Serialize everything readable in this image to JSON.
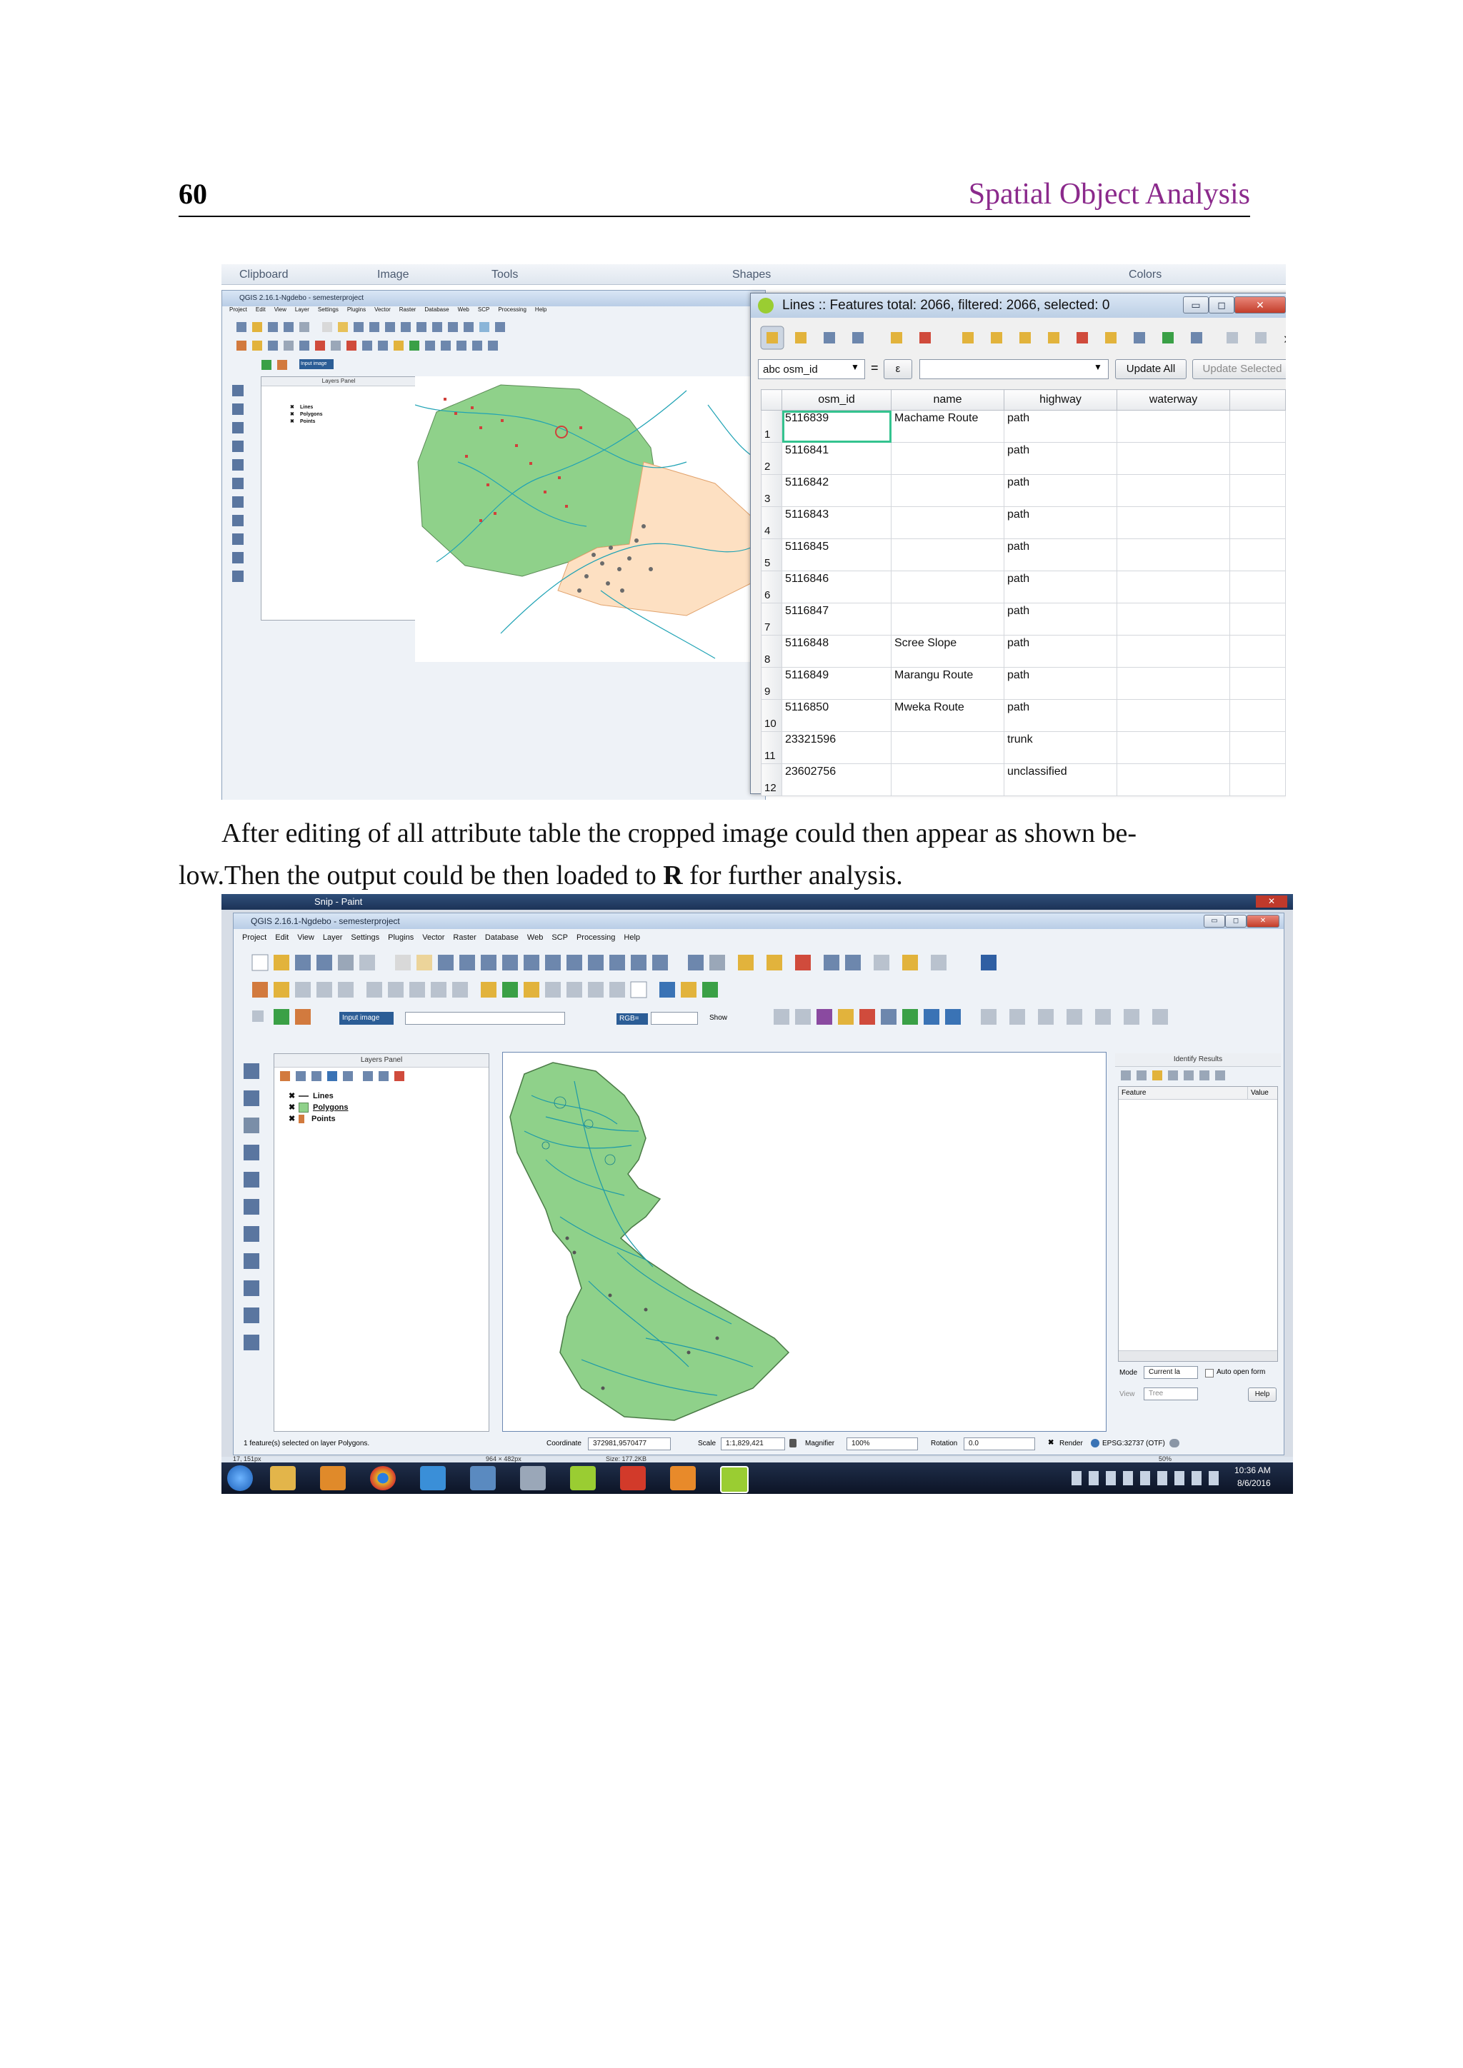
{
  "page": {
    "number": "60",
    "running_title": "Spatial Object Analysis",
    "paragraph_line1": "After editing of all attribute table the cropped image could then appear as shown be-",
    "paragraph_line2_a": "low.Then the output could be then loaded to ",
    "paragraph_line2_bold": "R",
    "paragraph_line2_b": " for further analysis."
  },
  "figure1": {
    "ribbon": [
      "Clipboard",
      "Image",
      "Tools",
      "Shapes",
      "Colors"
    ],
    "qgis_title": "QGIS 2.16.1-Ngdebo - semesterproject",
    "menu": [
      "Project",
      "Edit",
      "View",
      "Layer",
      "Settings",
      "Plugins",
      "Vector",
      "Raster",
      "Database",
      "Web",
      "SCP",
      "Processing",
      "Help"
    ],
    "layers_panel_title": "Layers Panel",
    "layers": [
      "Lines",
      "Polygons",
      "Points"
    ],
    "input_image_label": "Input image",
    "attr_dialog": {
      "title": "Lines :: Features total: 2066, filtered: 2066, selected: 0",
      "field_combo": "abc osm_id",
      "operator": "=",
      "expression_icon": "ε",
      "update_all": "Update All",
      "update_selected": "Update Selected",
      "overflow": "»",
      "columns": [
        "osm_id",
        "name",
        "highway",
        "waterway"
      ],
      "rows": [
        {
          "n": "1",
          "osm_id": "5116839",
          "name": "Machame Route",
          "highway": "path",
          "waterway": ""
        },
        {
          "n": "2",
          "osm_id": "5116841",
          "name": "",
          "highway": "path",
          "waterway": ""
        },
        {
          "n": "3",
          "osm_id": "5116842",
          "name": "",
          "highway": "path",
          "waterway": ""
        },
        {
          "n": "4",
          "osm_id": "5116843",
          "name": "",
          "highway": "path",
          "waterway": ""
        },
        {
          "n": "5",
          "osm_id": "5116845",
          "name": "",
          "highway": "path",
          "waterway": ""
        },
        {
          "n": "6",
          "osm_id": "5116846",
          "name": "",
          "highway": "path",
          "waterway": ""
        },
        {
          "n": "7",
          "osm_id": "5116847",
          "name": "",
          "highway": "path",
          "waterway": ""
        },
        {
          "n": "8",
          "osm_id": "5116848",
          "name": "Scree Slope",
          "highway": "path",
          "waterway": ""
        },
        {
          "n": "9",
          "osm_id": "5116849",
          "name": "Marangu Route",
          "highway": "path",
          "waterway": ""
        },
        {
          "n": "10",
          "osm_id": "5116850",
          "name": "Mweka Route",
          "highway": "path",
          "waterway": ""
        },
        {
          "n": "11",
          "osm_id": "23321596",
          "name": "",
          "highway": "trunk",
          "waterway": ""
        },
        {
          "n": "12",
          "osm_id": "23602756",
          "name": "",
          "highway": "unclassified",
          "waterway": ""
        }
      ]
    }
  },
  "figure2": {
    "paint_title": "Snip - Paint",
    "qgis_title": "QGIS 2.16.1-Ngdebo - semesterproject",
    "menu": [
      "Project",
      "Edit",
      "View",
      "Layer",
      "Settings",
      "Plugins",
      "Vector",
      "Raster",
      "Database",
      "Web",
      "SCP",
      "Processing",
      "Help"
    ],
    "input_image_label": "Input image",
    "rgb_label": "RGB=",
    "show_label": "Show",
    "layers_panel_title": "Layers Panel",
    "layers": [
      "Lines",
      "Polygons",
      "Points"
    ],
    "identify_title": "Identify Results",
    "identify_cols": [
      "Feature",
      "Value"
    ],
    "mode_label": "Mode",
    "mode_value": "Current la",
    "auto_open": "Auto open form",
    "view_label": "View",
    "view_value": "Tree",
    "help": "Help",
    "status_msg": "1 feature(s) selected on layer Polygons.",
    "coordinate_label": "Coordinate",
    "coordinate_value": "372981,9570477",
    "scale_label": "Scale",
    "scale_value": "1:1,829,421",
    "magnifier_label": "Magnifier",
    "magnifier_value": "100%",
    "rotation_label": "Rotation",
    "rotation_value": "0.0",
    "render_label": "Render",
    "crs": "EPSG:32737 (OTF)",
    "paint_status_pos": "17, 151px",
    "paint_status_size": "964 × 482px",
    "paint_status_filesize": "Size: 177.2KB",
    "paint_zoom": "50%",
    "clock_time": "10:36 AM",
    "clock_date": "8/6/2016"
  }
}
